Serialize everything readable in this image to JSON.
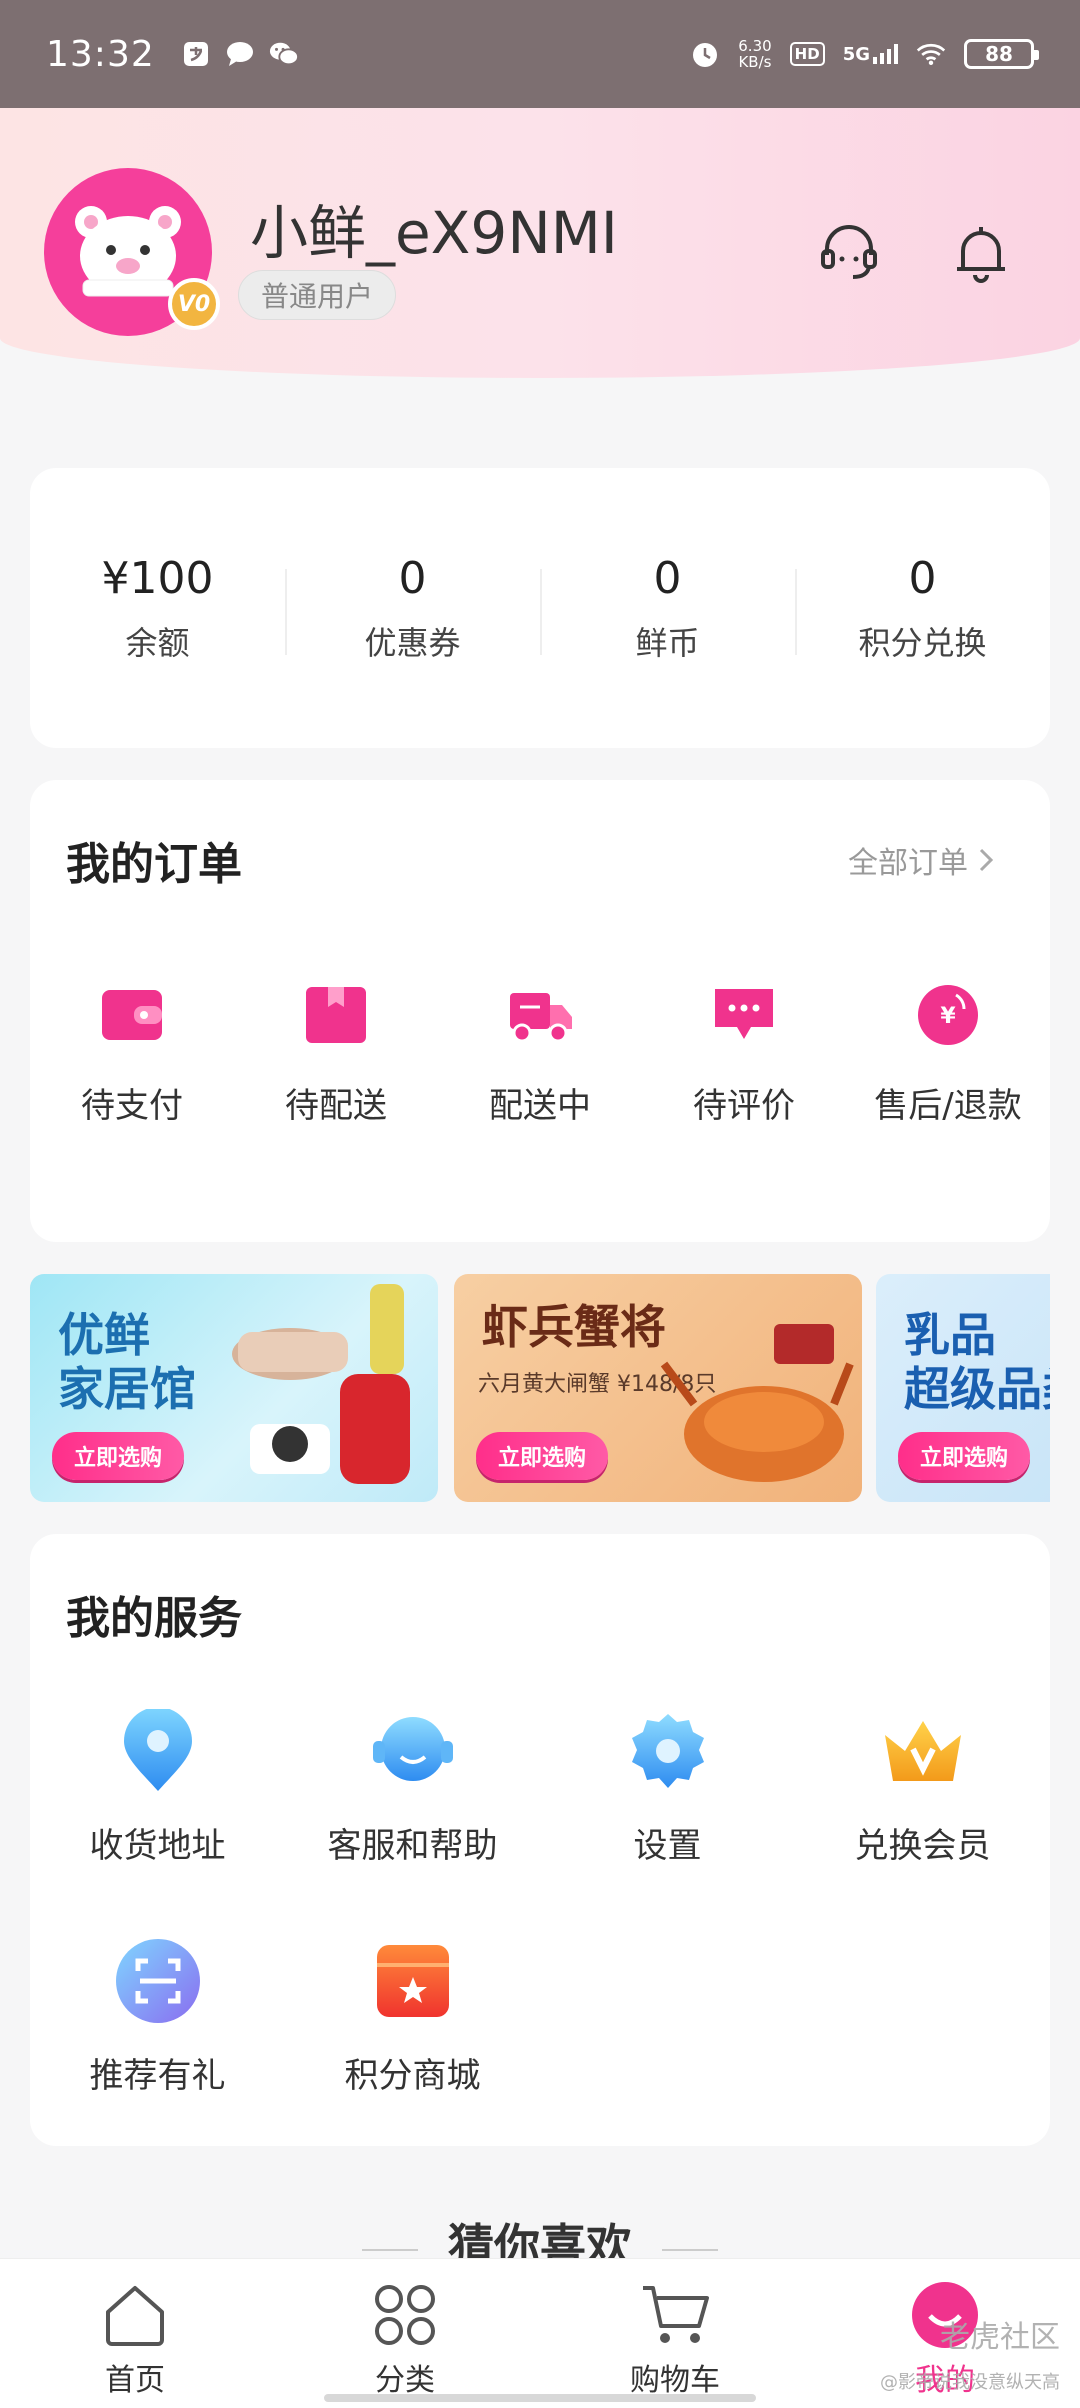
{
  "status_bar": {
    "time": "13:32",
    "net_speed_value": "6.30",
    "net_speed_unit": "KB/s",
    "hd": "HD",
    "network": "5G",
    "battery": "88"
  },
  "header": {
    "username": "小鲜_eX9NMI",
    "user_level": "普通用户",
    "vip_badge": "V0"
  },
  "assets": [
    {
      "value": "¥100",
      "label": "余额"
    },
    {
      "value": "0",
      "label": "优惠券"
    },
    {
      "value": "0",
      "label": "鲜币"
    },
    {
      "value": "0",
      "label": "积分兑换"
    }
  ],
  "orders": {
    "title": "我的订单",
    "all_label": "全部订单",
    "items": [
      {
        "label": "待支付",
        "icon": "wallet-icon"
      },
      {
        "label": "待配送",
        "icon": "package-icon"
      },
      {
        "label": "配送中",
        "icon": "truck-icon"
      },
      {
        "label": "待评价",
        "icon": "comment-icon"
      },
      {
        "label": "售后/退款",
        "icon": "refund-icon"
      }
    ]
  },
  "banners": [
    {
      "title_line1": "优鲜",
      "title_line2": "家居馆",
      "subtitle": "",
      "button": "立即选购"
    },
    {
      "title_line1": "虾兵蟹将",
      "title_line2": "",
      "subtitle": "六月黄大闸蟹 ¥148/8只",
      "button": "立即选购"
    },
    {
      "title_line1": "乳品",
      "title_line2": "超级品类",
      "subtitle": "",
      "button": "立即选购"
    }
  ],
  "services": {
    "title": "我的服务",
    "items": [
      {
        "label": "收货地址",
        "icon": "location-pin-icon"
      },
      {
        "label": "客服和帮助",
        "icon": "customer-service-icon"
      },
      {
        "label": "设置",
        "icon": "gear-icon"
      },
      {
        "label": "兑换会员",
        "icon": "crown-icon"
      },
      {
        "label": "推荐有礼",
        "icon": "scan-icon"
      },
      {
        "label": "积分商城",
        "icon": "store-icon"
      }
    ]
  },
  "guess_title": "猜你喜欢",
  "bottom_nav": [
    {
      "label": "首页",
      "icon": "home-icon"
    },
    {
      "label": "分类",
      "icon": "category-icon"
    },
    {
      "label": "购物车",
      "icon": "cart-icon"
    },
    {
      "label": "我的",
      "icon": "profile-icon",
      "active": true
    }
  ],
  "watermark": "老虎社区",
  "watermark_sub": "@影帝说我没意纵天高",
  "colors": {
    "accent": "#f0338d",
    "status_bar": "#7d6f71",
    "page_bg": "#f6f6f7"
  }
}
